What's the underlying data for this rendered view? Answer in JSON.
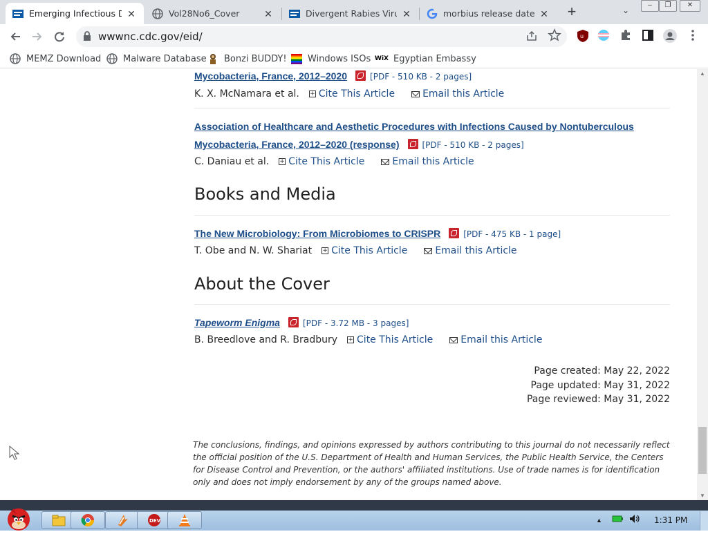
{
  "browser": {
    "tabs": [
      {
        "title": "Emerging Infectious Dis",
        "active": true,
        "icon": "cdc-favicon"
      },
      {
        "title": "Vol28No6_Cover",
        "active": false,
        "icon": "globe-icon"
      },
      {
        "title": "Divergent Rabies Virus",
        "active": false,
        "icon": "cdc-favicon"
      },
      {
        "title": "morbius release date -",
        "active": false,
        "icon": "google-icon"
      }
    ],
    "url": "wwwnc.cdc.gov/eid/",
    "bookmarks": [
      {
        "label": "MEMZ Download",
        "icon": "globe-icon"
      },
      {
        "label": "Malware Database",
        "icon": "globe-icon"
      },
      {
        "label": "Bonzi BUDDY!",
        "icon": "bonzi-icon"
      },
      {
        "label": "Windows ISOs",
        "icon": "rainbow-icon"
      },
      {
        "label": "Egyptian Embassy",
        "icon": "wix-icon"
      }
    ],
    "ext_badge": "3",
    "wix_label": "WiX"
  },
  "page": {
    "articles": [
      {
        "title_lines": [
          "Mycobacteria, France, 2012–2020"
        ],
        "pdf": "[PDF - 510 KB - 2 pages]",
        "authors": "K. X. McNamara et al."
      },
      {
        "title_lines": [
          "Association of Healthcare and Aesthetic Procedures with Infections Caused by Nontuberculous",
          "Mycobacteria, France, 2012–2020 (response)"
        ],
        "pdf": "[PDF - 510 KB - 2 pages]",
        "authors": "C. Daniau et al."
      }
    ],
    "sections": [
      {
        "heading": "Books and Media",
        "title": "The New Microbiology: From Microbiomes to CRISPR",
        "pdf": "[PDF - 475 KB - 1 page]",
        "authors": "T. Obe and N. W. Shariat"
      },
      {
        "heading": "About the Cover",
        "title": "Tapeworm Enigma",
        "pdf": "[PDF - 3.72 MB - 3 pages]",
        "authors": "B. Breedlove and R. Bradbury"
      }
    ],
    "cite_label": "Cite This Article",
    "email_label": "Email this Article",
    "dates": {
      "created": "Page created: May 22, 2022",
      "updated": "Page updated: May 31, 2022",
      "reviewed": "Page reviewed: May 31, 2022"
    },
    "disclaimer": "The conclusions, findings, and opinions expressed by authors contributing to this journal do not necessarily reflect the official position of the U.S. Department of Health and Human Services, the Public Health Service, the Centers for Disease Control and Prevention, or the authors' affiliated institutions. Use of trade names is for identification only and does not imply endorsement by any of the groups named above."
  },
  "taskbar": {
    "apps": [
      "explorer",
      "chrome",
      "winamp",
      "devcpp",
      "vlc"
    ],
    "clock": "1:31 PM"
  },
  "colors": {
    "link": "#1d4e89",
    "pdf_red": "#c9232c",
    "tabstrip": "#dee1e6"
  }
}
